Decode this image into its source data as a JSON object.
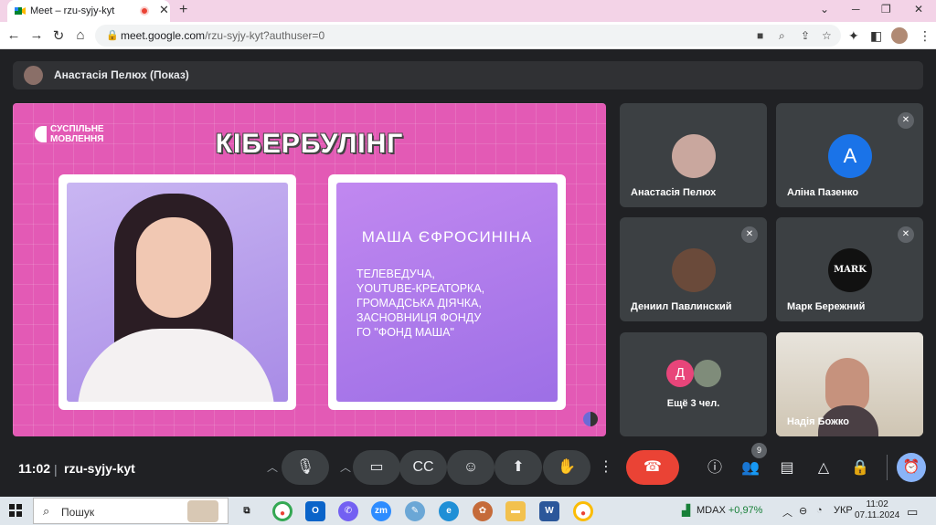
{
  "browser": {
    "tab_title": "Meet – rzu-syjy-kyt",
    "url_host": "meet.google.com",
    "url_path": "/rzu-syjy-kyt?authuser=0",
    "minimize": "─",
    "restore": "❐",
    "close": "✕"
  },
  "meet": {
    "presenter_label": "Анастасія Пелюх (Показ)",
    "slide": {
      "logo_line1": "СУСПІЛЬНЕ",
      "logo_line2": "МОВЛЕННЯ",
      "title": "КІБЕРБУЛІНГ",
      "person_name": "МАША ЄФРОСИНІНА",
      "description": "ТЕЛЕВЕДУЧА,\nYOUTUBE-КРЕАТОРКА,\nГРОМАДСЬКА ДІЯЧКА,\nЗАСНОВНИЦЯ ФОНДУ\nГО \"ФОНД МАША\""
    },
    "participants": [
      {
        "name": "Анастасія Пелюх",
        "avatar": "",
        "muted": false
      },
      {
        "name": "Аліна Пазенко",
        "avatar": "A",
        "muted": true
      },
      {
        "name": "Дениил Павлинский",
        "avatar": "",
        "muted": true
      },
      {
        "name": "Марк Бережний",
        "avatar": "MARK",
        "muted": true
      },
      {
        "name": "Ещё 3 чел.",
        "avatar": "Д",
        "muted": false
      },
      {
        "name": "Надія Божко",
        "avatar": "",
        "muted": false
      }
    ],
    "time": "11:02",
    "separator": "|",
    "meeting_code": "rzu-syjy-kyt",
    "participants_count": "9"
  },
  "taskbar": {
    "search_placeholder": "Пошук",
    "ticker_name": "MDAX",
    "ticker_change": "+0,97%",
    "language": "УКР",
    "clock_time": "11:02",
    "clock_date": "07.11.2024"
  },
  "colors": {
    "meet_bg": "#202124",
    "tile_bg": "#3c4043",
    "end_call": "#ea4335",
    "slide_pink": "#e35ab5",
    "avatar_blue": "#1a73e8",
    "avatar_pink": "#e8457a"
  }
}
